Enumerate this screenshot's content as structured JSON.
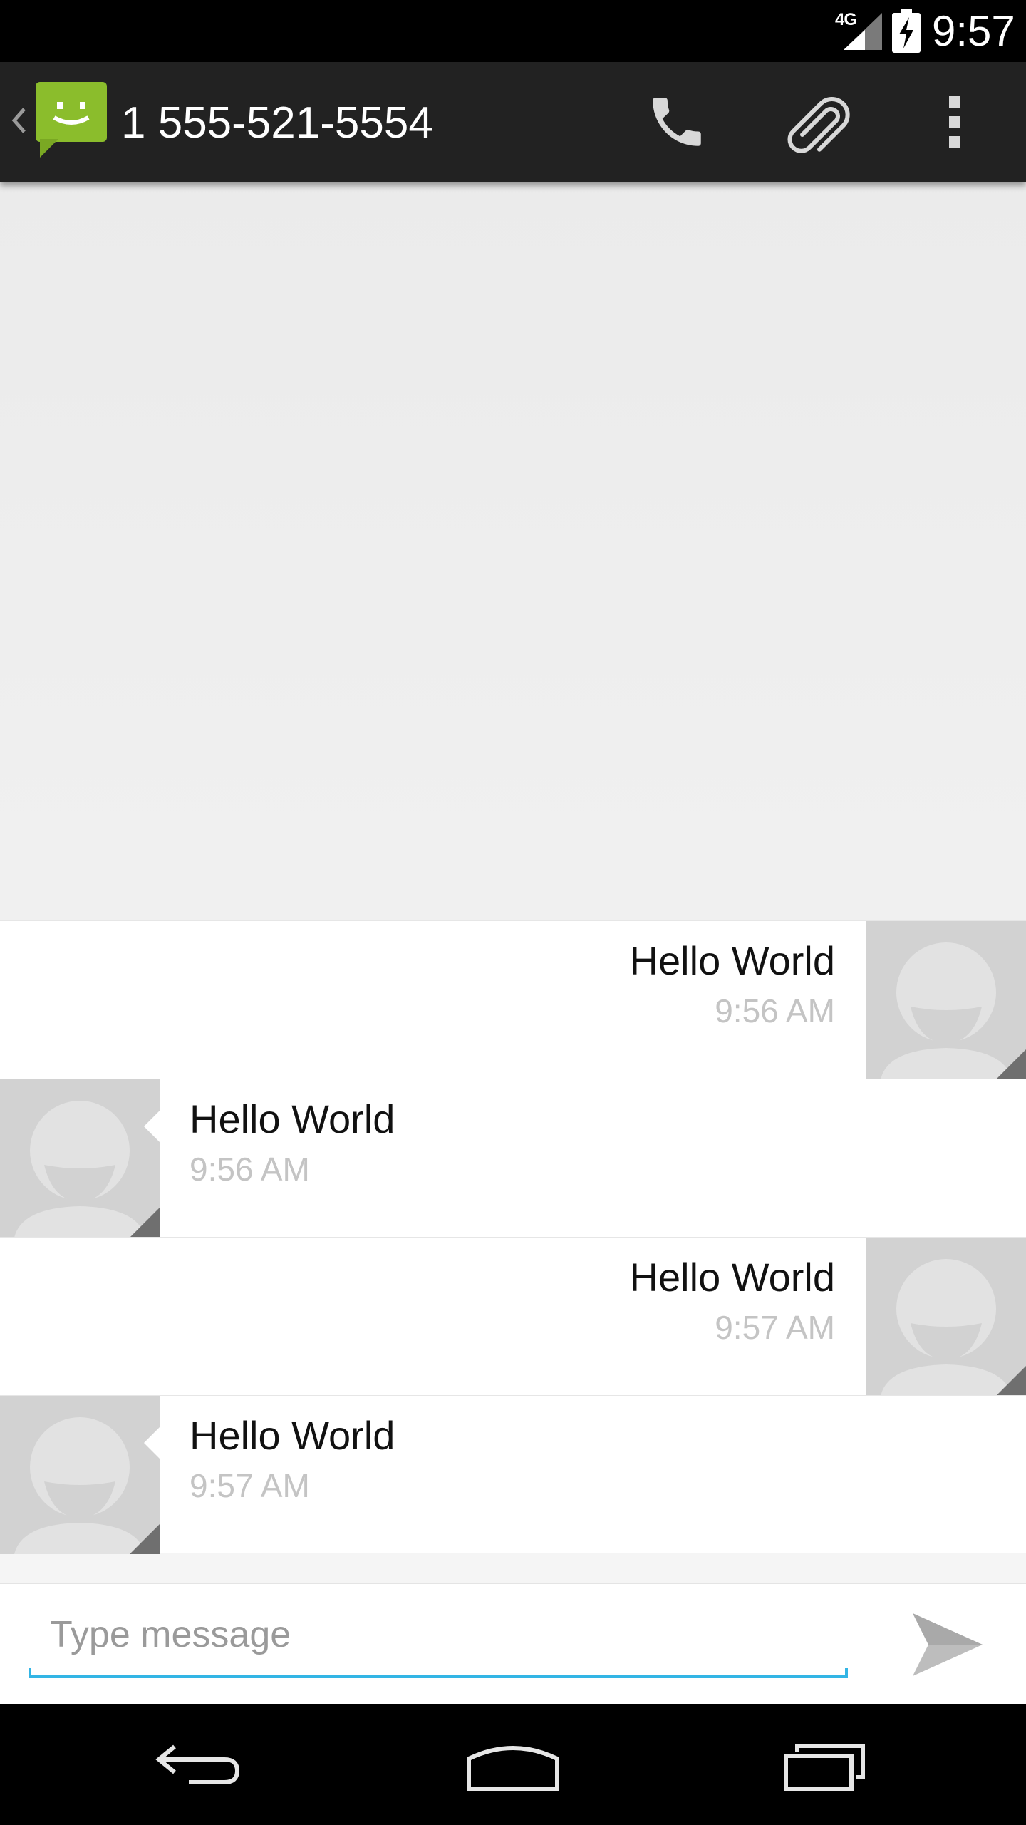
{
  "status_bar": {
    "network": "4G",
    "time": "9:57"
  },
  "action_bar": {
    "title": "1 555-521-5554",
    "actions": [
      "call-icon",
      "attach-icon",
      "overflow-menu-icon"
    ]
  },
  "messages": [
    {
      "direction": "outgoing",
      "text": "Hello World",
      "time": "9:56 AM"
    },
    {
      "direction": "incoming",
      "text": "Hello World",
      "time": "9:56 AM"
    },
    {
      "direction": "outgoing",
      "text": "Hello World",
      "time": "9:57 AM"
    },
    {
      "direction": "incoming",
      "text": "Hello World",
      "time": "9:57 AM"
    }
  ],
  "compose": {
    "placeholder": "Type message",
    "value": ""
  },
  "nav_bar": {
    "buttons": [
      "back-icon",
      "home-icon",
      "recents-icon"
    ]
  },
  "colors": {
    "action_bar": "#222222",
    "accent": "#33b5e5",
    "app_icon_green": "#8bbd2c",
    "timestamp": "#c4c4c4",
    "avatar_bg": "#d2d2d2"
  }
}
